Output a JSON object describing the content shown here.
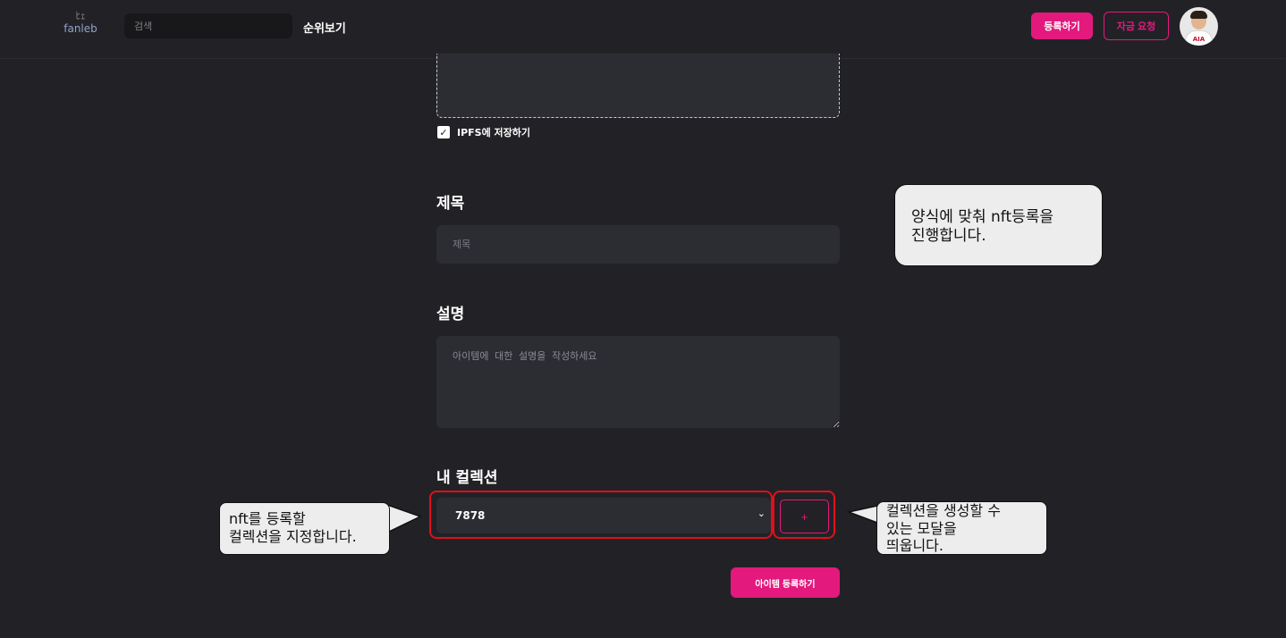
{
  "header": {
    "logo_mark": "ﾋｪ",
    "logo_text": "fanleb",
    "search_placeholder": "검색",
    "nav_rank": "순위보기",
    "register_button": "등록하기",
    "fund_button": "자금 요청",
    "avatar_sponsor": "AIA"
  },
  "form": {
    "ipfs_label": "IPFS에 저장하기",
    "ipfs_checked": true,
    "title_heading": "제목",
    "title_placeholder": "제목",
    "desc_heading": "설명",
    "desc_placeholder": "아이템에 대한 설명을 작성하세요",
    "collection_heading": "내 컬렉션",
    "collection_selected": "7878",
    "add_collection_label": "+",
    "submit_label": "아이템 등록하기"
  },
  "annotations": {
    "form_note": [
      "양식에 맞춰 nft등록을",
      "진행합니다."
    ],
    "collection_note": [
      "nft를 등록할",
      "컬렉션을 지정합니다."
    ],
    "add_note": [
      "컬렉션을 생성할 수",
      "있는 모달을",
      "띄웁니다."
    ],
    "highlight_color": "#e0101a"
  },
  "colors": {
    "accent": "#e3197e",
    "background": "#222226",
    "field": "#2c2c33"
  }
}
